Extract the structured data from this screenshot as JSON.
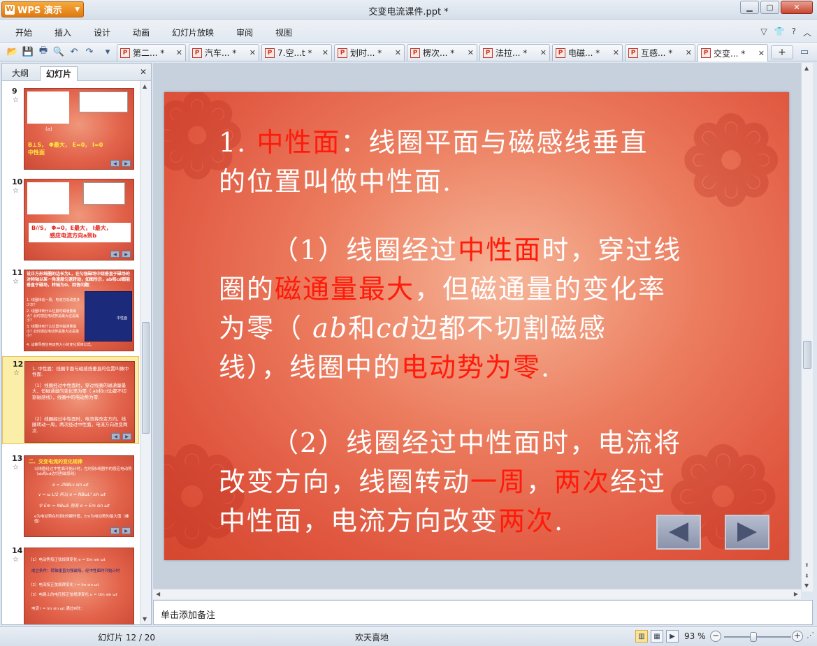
{
  "app": {
    "logo_label": "WPS 演示",
    "window_title": "交变电流课件.ppt *"
  },
  "menu": {
    "items": [
      "开始",
      "插入",
      "设计",
      "动画",
      "幻灯片放映",
      "审阅",
      "视图"
    ]
  },
  "doc_tabs": [
    {
      "label": "第二... *"
    },
    {
      "label": "汽车... *"
    },
    {
      "label": "7.空...t *"
    },
    {
      "label": "划时... *"
    },
    {
      "label": "楞次... *"
    },
    {
      "label": "法拉... *"
    },
    {
      "label": "电磁... *"
    },
    {
      "label": "互感... *"
    },
    {
      "label": "交变... *"
    }
  ],
  "new_tab_label": "+",
  "left_panel": {
    "tabs": [
      "大纲",
      "幻灯片"
    ],
    "active_tab": "幻灯片",
    "thumbnails": [
      {
        "number": "9",
        "caption": "B⊥S，  Φ最大，  E=0，  I=0",
        "caption2": "中性面",
        "fig_label": "(a)"
      },
      {
        "number": "10",
        "caption": "B//S，  Φ=0，E最大，  I最大，",
        "caption2": "感应电流方向a到b"
      },
      {
        "number": "11",
        "caption": "设正方形线圈的边长为L，在匀强磁场中绕垂直于磁场的对称轴以某一角速度匀速转动，如图所示，ab和cd都能垂直于磁场，转轴为O，回答问题：",
        "q1": "1. 线圈转动一周，电流方向改变多少次？",
        "q2": "2. 线圈转到什么位置时磁通量最大？此时感应电动势是最大还是最小？",
        "q3": "3. 线圈转到什么位置时磁通量最小？此时感应电动势是最大还是最小？",
        "q4": "4. 试推导感应电动势大小的变化规律公式。",
        "fig_label": "中性面"
      },
      {
        "number": "12",
        "caption": "1. 中性面：线圈平面与磁感线垂直的位置叫做中性面.",
        "p1": "（1）线圈经过中性面时，穿过线圈的磁通量最大，但磁通量的变化率为零（  ab和cd边都不切割磁感线），线圈中的电动势为零.",
        "p2": "（2）线圈经过中性面时，电流将改变方向，线圈转动一周，两次经过中性面，电流方向改变两次."
      },
      {
        "number": "13",
        "caption": "二、交变电流的变化规律",
        "p1": "以线圈经过中性面开始计时，在时刻t线圈中的感应电动势（ab和cd边切割磁感线）",
        "f1": "e = 2NBLv sin ωt",
        "f2": "v = ω L/2    所以 e = NBωL² sin ωt",
        "f3": "令 Em = NBωS    则有 e = Em sin ωt",
        "p2": "e为电动势在时刻t的瞬时值，Em为电动势的最大值（峰值）"
      },
      {
        "number": "14",
        "l1": "（1）电动势按正弦规律变化    e = Em sin ωt",
        "l2": "成立条件：转轴垂直匀强磁场，经中性面时开始计时",
        "l3": "（2）电流按正弦规律变化    i = Im sin ωt",
        "l4": "（3）电路上的电压按正弦规律变化    u = Um sin ωt",
        "l5": "电流  i = Im sin ωt    通过R时："
      }
    ]
  },
  "slide": {
    "line1_prefix": "1. ",
    "line1_red": "中性面",
    "line1_rest": "：线圈平面与磁感线垂直",
    "line2": "的位置叫做中性面.",
    "p1_a": "（1）线圈经过",
    "p1_red1": "中性面",
    "p1_b": "时，穿过线",
    "p1_c": "圈的",
    "p1_red2": "磁通量最大",
    "p1_d": "，但磁通量的变化率",
    "p1_e": "为零（  ",
    "p1_ab": "ab",
    "p1_f": "和",
    "p1_cd": "cd",
    "p1_g": "边都不切割磁感",
    "p1_h": "线），线圈中的",
    "p1_red3": "电动势为零",
    "p1_i": ".",
    "p2_a": "（2）线圈经过中性面时，电流将",
    "p2_b": "改变方向，线圈转动",
    "p2_red1": "一周",
    "p2_c": "，",
    "p2_red2": "两次",
    "p2_d": "经过",
    "p2_e": "中性面，电流方向改变",
    "p2_red3": "两次",
    "p2_f": "."
  },
  "notes_placeholder": "单击添加备注",
  "status": {
    "slide_counter": "幻灯片 12 / 20",
    "theme": "欢天喜地",
    "zoom": "93 %"
  },
  "colors": {
    "accent_orange": "#e07a10",
    "slide_red_text": "#ff1a0a",
    "selected_thumb": "#fbeea8"
  }
}
